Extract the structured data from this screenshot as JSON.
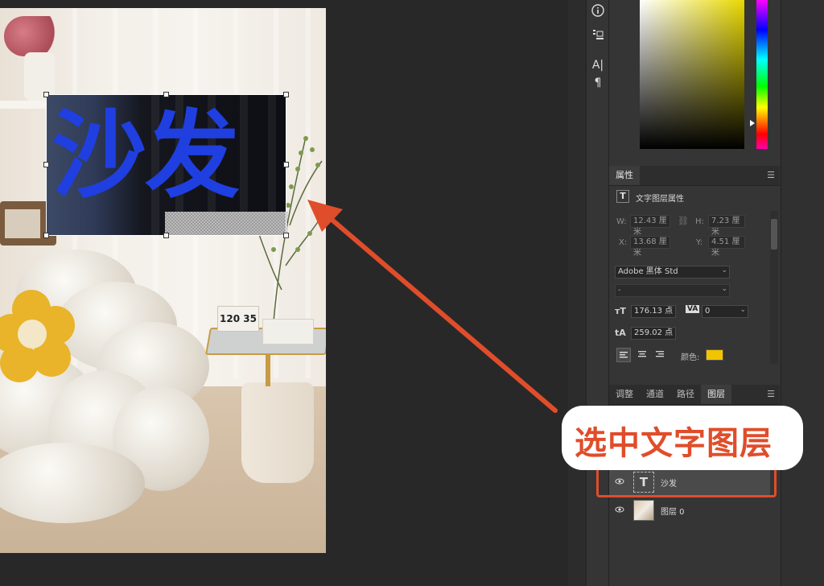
{
  "canvas": {
    "text_layer_content": "沙发",
    "clock_digits": "120 35"
  },
  "annotation": {
    "callout_text": "选中文字图层",
    "accent_color": "#e04d2a"
  },
  "tools": {
    "info_icon": "info-icon",
    "stamp_icon": "clone-stamp-icon",
    "character_icon": "A|",
    "paragraph_icon": "¶"
  },
  "properties": {
    "tab_label": "属性",
    "layer_type_label": "文字图层属性",
    "w_label": "W:",
    "w_value": "12.43 厘米",
    "h_label": "H:",
    "h_value": "7.23 厘米",
    "x_label": "X:",
    "x_value": "13.68 厘米",
    "y_label": "Y:",
    "y_value": "4.51 厘米",
    "font_family": "Adobe 黑体 Std",
    "font_style": "-",
    "font_size": "176.13 点",
    "tracking": "0",
    "leading": "259.02 点",
    "color_label": "颜色:",
    "text_color": "#f2c400"
  },
  "layers_panel": {
    "tabs": [
      "调整",
      "通道",
      "路径",
      "图层"
    ],
    "active_tab": "图层",
    "layers": [
      {
        "name": "沙发",
        "type": "text",
        "visible": true
      },
      {
        "name": "图层 0",
        "type": "image",
        "visible": true
      }
    ]
  },
  "colors": {
    "text_fill": "#1f3fe0",
    "panel_bg": "#353535"
  }
}
